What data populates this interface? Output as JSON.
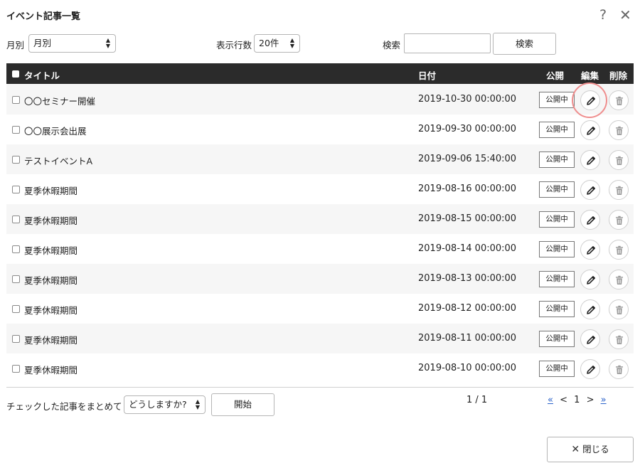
{
  "dialog": {
    "title": "イベント記事一覧"
  },
  "toolbar": {
    "month_label": "月別",
    "month_value": "月別",
    "rows_label": "表示行数",
    "rows_value": "20件",
    "search_label": "検索",
    "search_value": "",
    "search_button": "検索"
  },
  "table": {
    "headers": {
      "title": "タイトル",
      "date": "日付",
      "publish": "公開",
      "edit": "編集",
      "delete": "削除"
    },
    "rows": [
      {
        "title": "〇〇セミナー開催",
        "date": "2019-10-30 00:00:00",
        "status": "公開中"
      },
      {
        "title": "〇〇展示会出展",
        "date": "2019-09-30 00:00:00",
        "status": "公開中"
      },
      {
        "title": "テストイベントA",
        "date": "2019-09-06 15:40:00",
        "status": "公開中"
      },
      {
        "title": "夏季休暇期間",
        "date": "2019-08-16 00:00:00",
        "status": "公開中"
      },
      {
        "title": "夏季休暇期間",
        "date": "2019-08-15 00:00:00",
        "status": "公開中"
      },
      {
        "title": "夏季休暇期間",
        "date": "2019-08-14 00:00:00",
        "status": "公開中"
      },
      {
        "title": "夏季休暇期間",
        "date": "2019-08-13 00:00:00",
        "status": "公開中"
      },
      {
        "title": "夏季休暇期間",
        "date": "2019-08-12 00:00:00",
        "status": "公開中"
      },
      {
        "title": "夏季休暇期間",
        "date": "2019-08-11 00:00:00",
        "status": "公開中"
      },
      {
        "title": "夏季休暇期間",
        "date": "2019-08-10 00:00:00",
        "status": "公開中"
      }
    ]
  },
  "bulk": {
    "label": "チェックした記事をまとめて",
    "action_value": "どうしますか?",
    "start_button": "開始"
  },
  "pagination": {
    "info": "1 / 1",
    "first": "«",
    "prev": "<",
    "current": "1",
    "next": ">",
    "last": "»"
  },
  "footer": {
    "close_button": "閉じる"
  },
  "colors": {
    "header_bg": "#2b2b2b",
    "link": "#2a62c9",
    "highlight": "#ef8e8e"
  },
  "icons": {
    "help": "help-icon",
    "close": "close-icon",
    "edit": "pencil-icon",
    "delete": "trash-icon"
  }
}
